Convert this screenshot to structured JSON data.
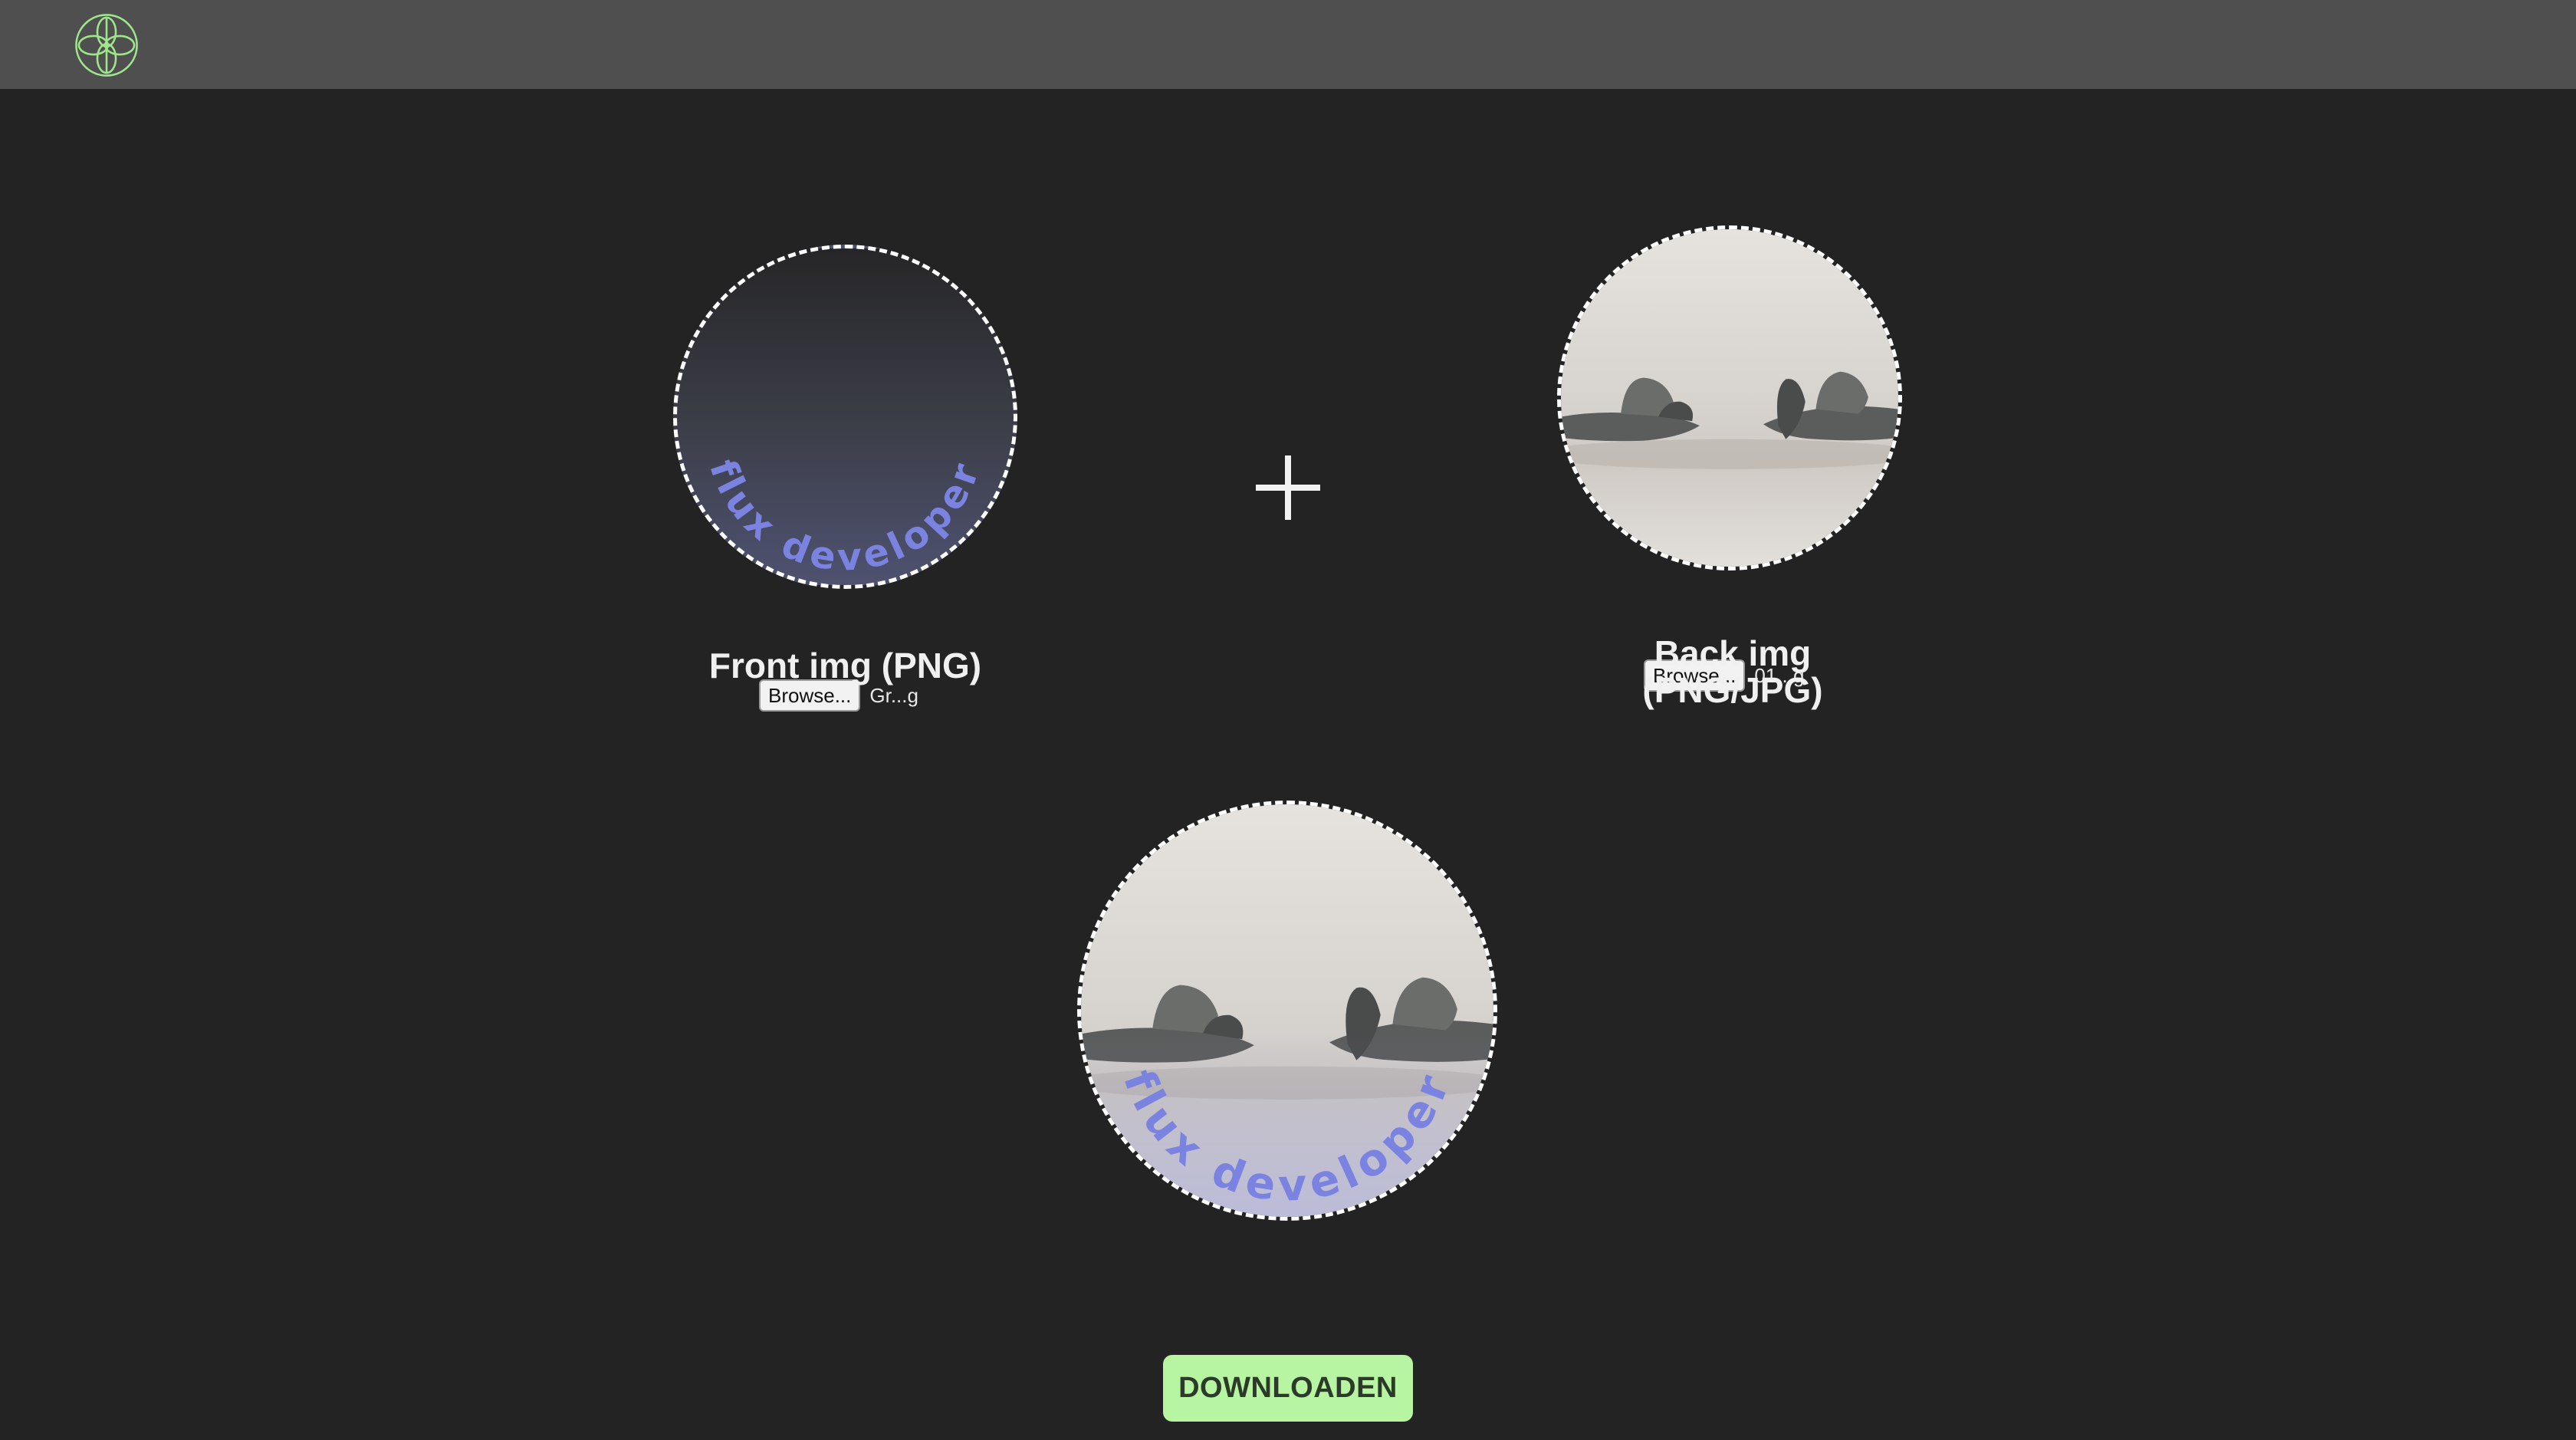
{
  "header": {
    "logo_icon": "flower-logo-icon",
    "accent_color": "#9fe58c"
  },
  "front": {
    "browse_label": "Browse...",
    "filename": "Gr...g",
    "label": "Front img (PNG)",
    "overlay_text": "flux developer"
  },
  "operator": {
    "icon": "plus-icon"
  },
  "back": {
    "browse_label": "Browse...",
    "filename": "01...g",
    "label_line1": "Back img",
    "label_line2": "(PNG/JPG)"
  },
  "result": {
    "overlay_text": "flux developer",
    "download_label": "DOWNLOADEN",
    "download_color": "#b7f5a3"
  }
}
